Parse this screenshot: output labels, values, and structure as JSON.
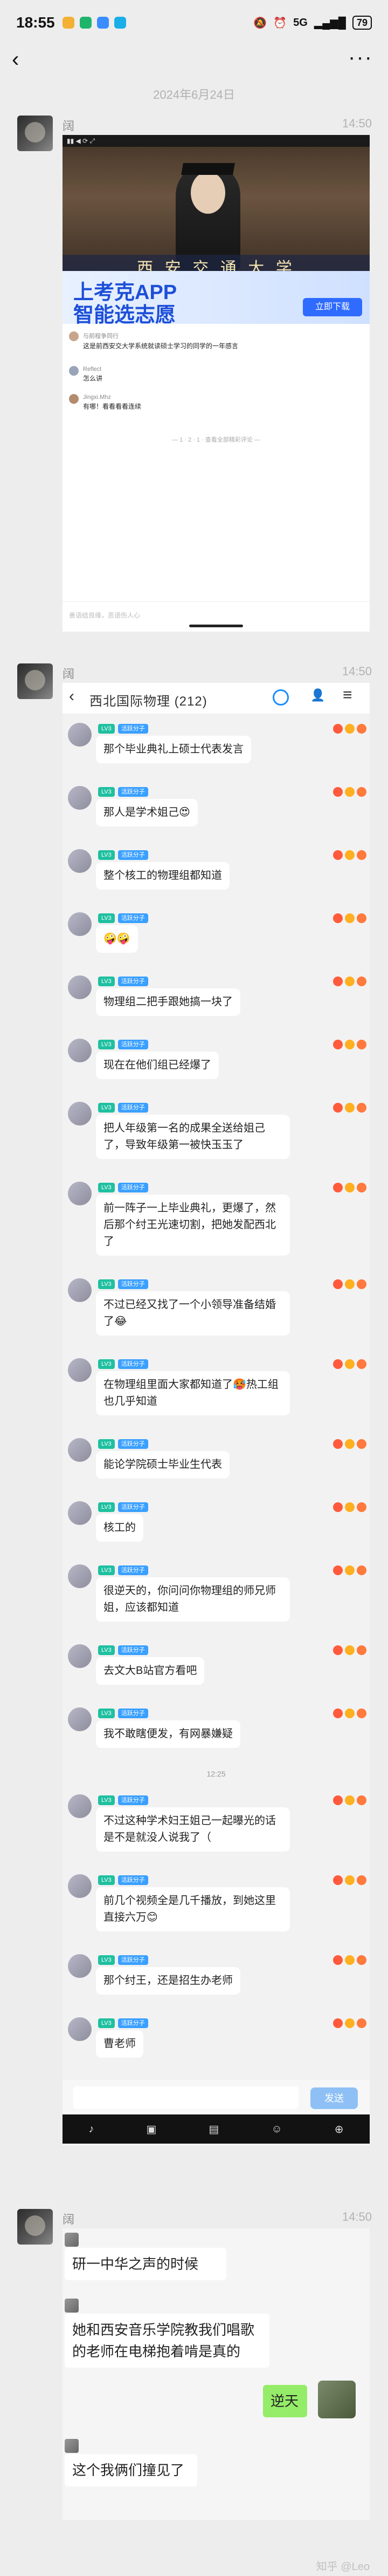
{
  "status_bar": {
    "time": "18:55",
    "battery": "79",
    "network": "5G"
  },
  "nav": {
    "back_icon": "chevron-left",
    "more_icon": "ellipsis"
  },
  "date_divider": "2024年6月24日",
  "messages": [
    {
      "sender": "阔",
      "time": "14:50",
      "screenshot": {
        "video_banner": "西 安 交 通 大 学",
        "ad_line1": "上考克APP",
        "ad_line2": "智能选志愿",
        "ad_button": "立即下载",
        "comments": [
          {
            "name": "与前程争同行",
            "text": "这是前西安交大学系统就读硕士学习的同学的一年感言"
          },
          {
            "name": "Reflect",
            "text": "怎么讲"
          },
          {
            "name": "Jingxi.Mhz",
            "text": "有哪！看看看看连续"
          }
        ],
        "footer": "— 1 · 2 · 1 · 查看全部精彩评论 —",
        "input_placeholder": "善语结良缘，恶语伤人心"
      }
    },
    {
      "sender": "阔",
      "time": "14:50",
      "qq": {
        "header_title": "西北国际物理 (212)",
        "send_label": "发送",
        "time_divider": "12:25",
        "tools": [
          "♪",
          "▣",
          "▤",
          "☺",
          "⊕"
        ],
        "tag_role": "LV3",
        "tag_title": "活跃分子",
        "messages": [
          "那个毕业典礼上硕士代表发言",
          "那人是学术姐己😍",
          "整个核工的物理组都知道",
          "🤪🤪",
          "物理组二把手跟她搞一块了",
          "现在在他们组已经爆了",
          "把人年级第一名的成果全送给姐己了，导致年级第一被快玉玉了",
          "前一阵子一上毕业典礼，更爆了，然后那个纣王光速切割，把她发配西北了",
          "不过已经又找了一个小领导准备结婚了😂",
          "在物理组里面大家都知道了🥵热工组也几乎知道",
          "能论学院硕士毕业生代表",
          "核工的",
          "很逆天的，你问问你物理组的师兄师姐，应该都知道",
          "去文大B站官方看吧",
          "我不敢瞎便发，有网暴嫌疑",
          "不过这种学术妇王姐己一起曝光的话是不是就没人说我了（",
          "前几个视频全是几千播放，到她这里直接六万😊",
          "那个纣王，还是招生办老师",
          "曹老师"
        ]
      }
    },
    {
      "sender": "阔",
      "time": "14:50",
      "chat": {
        "bubbles": [
          {
            "side": "left",
            "text": "研一中华之声的时候"
          },
          {
            "side": "left",
            "text": "她和西安音乐学院教我们唱歌的老师在电梯抱着啃是真的"
          },
          {
            "side": "right",
            "text": "逆天"
          },
          {
            "side": "left",
            "text": "这个我俩们撞见了"
          }
        ]
      }
    }
  ],
  "watermark": "知乎 @Leo"
}
